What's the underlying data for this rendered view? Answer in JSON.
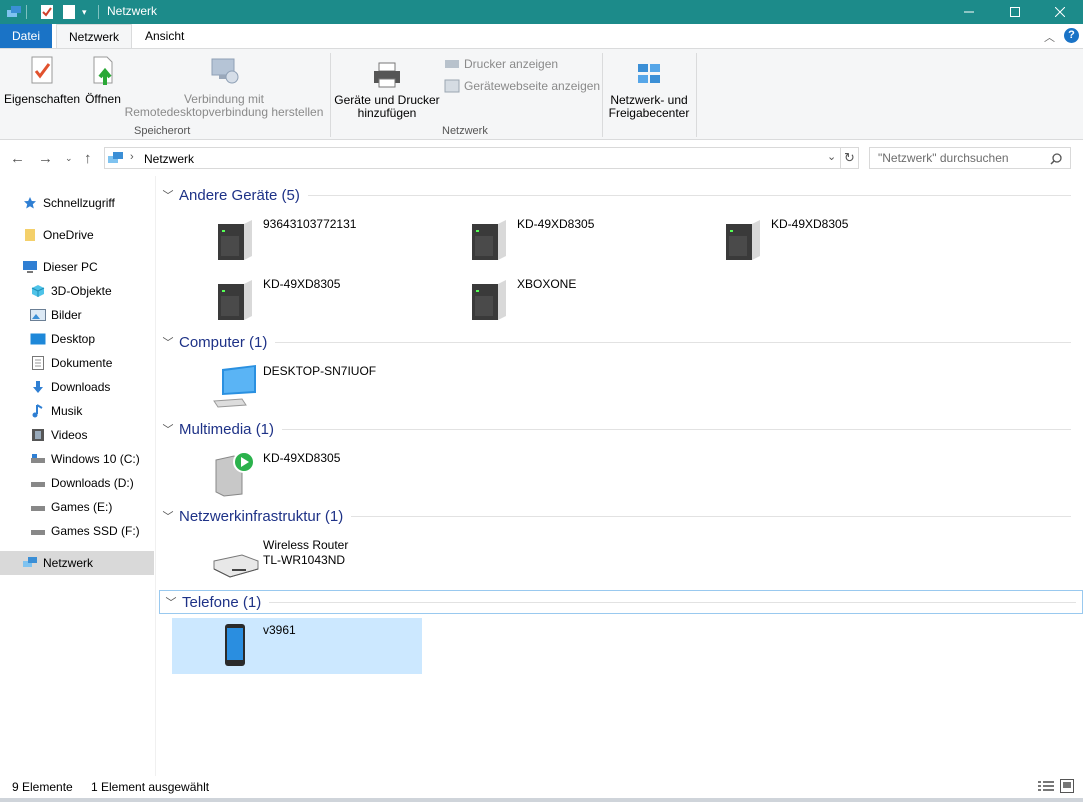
{
  "window": {
    "title": "Netzwerk"
  },
  "tabs": {
    "file": "Datei",
    "network": "Netzwerk",
    "view": "Ansicht"
  },
  "ribbon": {
    "properties": "Eigenschaften",
    "open": "Öffnen",
    "remote_line1": "Verbindung mit",
    "remote_line2": "Remotedesktopverbindung herstellen",
    "group_location": "Speicherort",
    "add_devices_line1": "Geräte und Drucker",
    "add_devices_line2": "hinzufügen",
    "show_printers": "Drucker anzeigen",
    "show_device_page": "Gerätewebseite anzeigen",
    "group_network": "Netzwerk",
    "network_center_line1": "Netzwerk- und",
    "network_center_line2": "Freigabecenter"
  },
  "address": {
    "path": "Netzwerk",
    "search_placeholder": "\"Netzwerk\" durchsuchen"
  },
  "nav": [
    {
      "label": "Schnellzugriff",
      "icon": "star-icon"
    },
    {
      "label": "OneDrive",
      "icon": "folder-icon"
    },
    {
      "label": "Dieser PC",
      "icon": "pc-icon"
    },
    {
      "label": "3D-Objekte",
      "icon": "cube-icon"
    },
    {
      "label": "Bilder",
      "icon": "pictures-icon"
    },
    {
      "label": "Desktop",
      "icon": "desktop-icon"
    },
    {
      "label": "Dokumente",
      "icon": "documents-icon"
    },
    {
      "label": "Downloads",
      "icon": "download-icon"
    },
    {
      "label": "Musik",
      "icon": "music-icon"
    },
    {
      "label": "Videos",
      "icon": "video-icon"
    },
    {
      "label": "Windows 10 (C:)",
      "icon": "windows-drive-icon"
    },
    {
      "label": "Downloads (D:)",
      "icon": "drive-icon"
    },
    {
      "label": "Games (E:)",
      "icon": "drive-icon"
    },
    {
      "label": "Games SSD (F:)",
      "icon": "drive-icon"
    },
    {
      "label": "Netzwerk",
      "icon": "network-icon"
    }
  ],
  "groups": {
    "other": {
      "title": "Andere Geräte (5)",
      "items": [
        "93643103772131",
        "KD-49XD8305",
        "KD-49XD8305",
        "KD-49XD8305",
        "XBOXONE"
      ]
    },
    "computer": {
      "title": "Computer (1)",
      "items": [
        "DESKTOP-SN7IUOF"
      ]
    },
    "multimedia": {
      "title": "Multimedia (1)",
      "items": [
        "KD-49XD8305"
      ]
    },
    "infra": {
      "title": "Netzwerkinfrastruktur (1)",
      "items": [
        {
          "line1": "Wireless Router",
          "line2": "TL-WR1043ND"
        }
      ]
    },
    "phones": {
      "title": "Telefone (1)",
      "items": [
        "v3961"
      ]
    }
  },
  "status": {
    "count": "9 Elemente",
    "selected": "1 Element ausgewählt"
  },
  "colors": {
    "titlebar": "#1c8b8a",
    "file_tab": "#1a73c6",
    "group_title": "#1e3287",
    "selection": "#cce8ff"
  }
}
